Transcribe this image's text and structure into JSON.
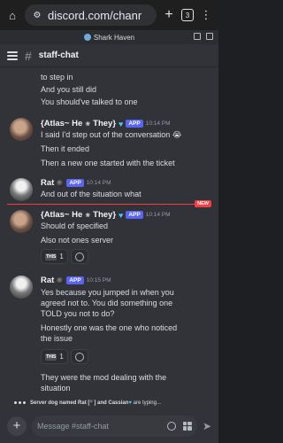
{
  "browser": {
    "url": "discord.com/chanr",
    "tab_count": "3"
  },
  "server": {
    "name": "Shark Haven"
  },
  "channel": {
    "name": "staff-chat"
  },
  "messages": {
    "lead_lines": [
      "to step in",
      "And you still did",
      "You should've talked to one"
    ],
    "m1": {
      "author": "{Atlas~ He",
      "author_suffix": "They}",
      "badge": "APP",
      "time": "10:14 PM",
      "lines": [
        "I said I'd step out of the conversation",
        "Then it ended",
        "Then a new one started with the ticket"
      ]
    },
    "m2": {
      "author": "Rat",
      "badge": "APP",
      "time": "10:14 PM",
      "lines": [
        "And out of the situation what"
      ]
    },
    "new_label": "NEW",
    "m3": {
      "author": "{Atlas~ He",
      "author_suffix": "They}",
      "badge": "APP",
      "time": "10:14 PM",
      "lines": [
        "Should of specified",
        "Also not ones server"
      ],
      "reaction": {
        "emoji_text": "THIS",
        "count": "1"
      }
    },
    "m4": {
      "author": "Rat",
      "badge": "APP",
      "time": "10:15 PM",
      "lines": [
        "Yes because you jumped in when you",
        "agreed not to. You did something one",
        "TOLD you not to do?",
        "Honestly one was the one who noticed",
        "the issue"
      ],
      "reaction": {
        "emoji_text": "THIS",
        "count": "1"
      },
      "tail_lines": [
        "They were the mod dealing with the",
        "situation"
      ]
    }
  },
  "typing": {
    "text_a": "Server dog named Rat [",
    "text_b": "] and Cassian",
    "text_c": " are typing..."
  },
  "composer": {
    "placeholder": "Message #staff-chat"
  }
}
